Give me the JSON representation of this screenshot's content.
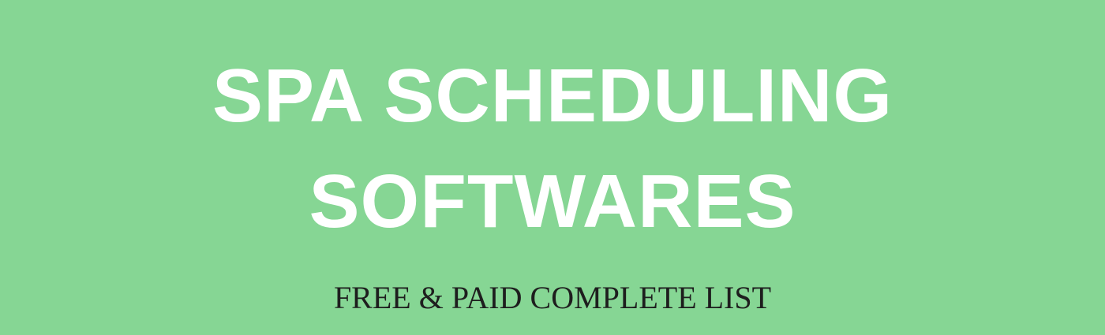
{
  "banner": {
    "title_line_1": "SPA SCHEDULING",
    "title_line_2": "SOFTWARES",
    "subtitle": "FREE & PAID COMPLETE LIST",
    "background_color": "#86d694",
    "title_color": "#ffffff",
    "subtitle_color": "#1e1e1e"
  }
}
